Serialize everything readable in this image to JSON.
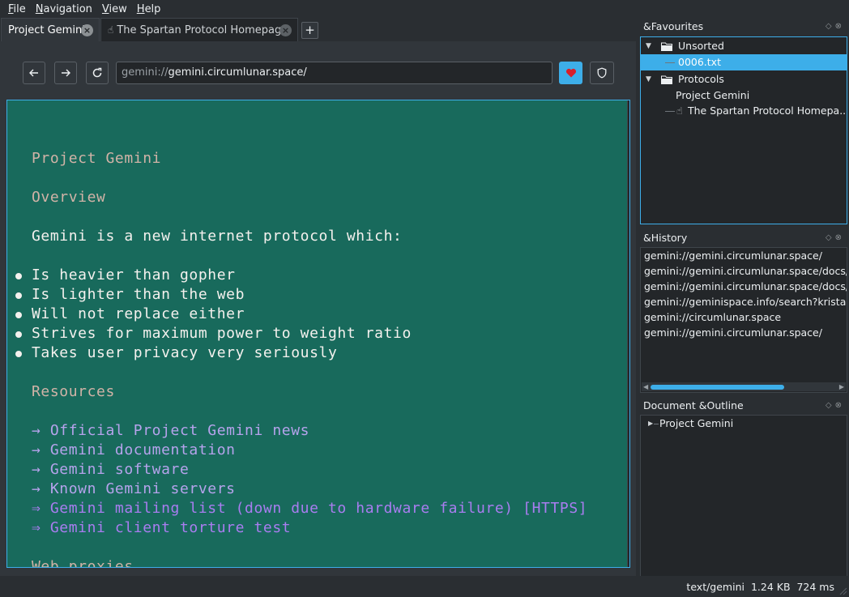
{
  "menubar": {
    "items": [
      {
        "accel": "F",
        "rest": "ile"
      },
      {
        "accel": "N",
        "rest": "avigation"
      },
      {
        "accel": "V",
        "rest": "iew"
      },
      {
        "accel": "H",
        "rest": "elp"
      }
    ]
  },
  "tabs": [
    {
      "label": "Project Gemini",
      "active": true
    },
    {
      "label": "The Spartan Protocol Homepage",
      "active": false
    }
  ],
  "new_tab_label": "+",
  "toolbar": {
    "url_scheme": "gemini://",
    "url_rest": "gemini.circumlunar.space/",
    "favourite_color": "#3daee9"
  },
  "document": {
    "title": "Project Gemini",
    "overview_heading": "Overview",
    "intro": "Gemini is a new internet protocol which:",
    "bullets": [
      "Is heavier than gopher",
      "Is lighter than the web",
      "Will not replace either",
      "Strives for maximum power to weight ratio",
      "Takes user privacy very seriously"
    ],
    "resources_heading": "Resources",
    "links": [
      {
        "arrow": "→",
        "text": "Official Project Gemini news",
        "external": false
      },
      {
        "arrow": "→",
        "text": "Gemini documentation",
        "external": false
      },
      {
        "arrow": "→",
        "text": "Gemini software",
        "external": false
      },
      {
        "arrow": "→",
        "text": "Known Gemini servers",
        "external": false
      },
      {
        "arrow": "⇒",
        "text": "Gemini mailing list (down due to hardware failure) [HTTPS]",
        "external": true
      },
      {
        "arrow": "⇒",
        "text": "Gemini client torture test",
        "external": true
      }
    ],
    "next_heading": "Web proxies",
    "background_color": "#186a5c"
  },
  "favourites": {
    "title": "&Favourites",
    "folders": [
      {
        "name": "Unsorted",
        "items": [
          "0006.txt"
        ]
      },
      {
        "name": "Protocols",
        "items": [
          "Project Gemini",
          "The Spartan Protocol Homepa..."
        ]
      }
    ]
  },
  "history": {
    "title": "&History",
    "items": [
      "gemini://gemini.circumlunar.space/",
      "gemini://gemini.circumlunar.space/docs/",
      "gemini://gemini.circumlunar.space/docs/sp",
      "gemini://geminispace.info/search?kristall l",
      "gemini://circumlunar.space",
      "gemini://gemini.circumlunar.space/"
    ]
  },
  "outline": {
    "title": "Document &Outline",
    "items": [
      "Project Gemini"
    ]
  },
  "status": {
    "mime": "text/gemini",
    "size": "1.24 KB",
    "time": "724 ms"
  },
  "colors": {
    "accent": "#3daee9",
    "window_bg": "#31363b",
    "view_bg": "#232629"
  }
}
